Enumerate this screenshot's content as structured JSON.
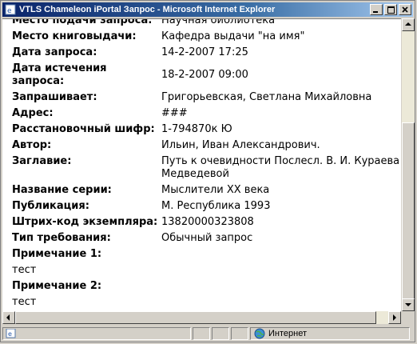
{
  "window": {
    "title": "VTLS Chameleon iPortal Запрос - Microsoft Internet Explorer",
    "buttons": [
      "minimize",
      "maximize",
      "close"
    ]
  },
  "fields": [
    {
      "label": "Место подачи запроса:",
      "value": "Научная библиотека"
    },
    {
      "label": "Место книговыдачи:",
      "value": "Кафедра выдачи \"на имя\""
    },
    {
      "label": "Дата запроса:",
      "value": "14-2-2007 17:25"
    },
    {
      "label": "Дата истечения",
      "label2": "запроса:",
      "value": "18-2-2007 09:00"
    },
    {
      "label": "Запрашивает:",
      "value": "Григорьевская, Светлана Михайловна"
    },
    {
      "label": "Адрес:",
      "value": "###"
    },
    {
      "label": "Расстановочный шифр:",
      "value": "1-794870к Ю"
    },
    {
      "label": "Автор:",
      "value": "Ильин, Иван Александрович."
    },
    {
      "label": "Заглавие:",
      "value": "Путь к очевидности Послесл. В. И. Кураева",
      "value2": "Медведевой"
    },
    {
      "label": "Название серии:",
      "value": "Мыслители XX века"
    },
    {
      "label": "Публикация:",
      "value": "М. Республика 1993"
    },
    {
      "label": "Штрих-код экземпляра:",
      "value": "13820000323808"
    },
    {
      "label": "Тип требования:",
      "value": "Обычный запрос"
    },
    {
      "label": "Примечание 1:",
      "value": ""
    },
    {
      "label": "тест",
      "value": "",
      "plain": true
    },
    {
      "label": "Примечание 2:",
      "value": ""
    },
    {
      "label": "тест",
      "value": "",
      "plain": true
    }
  ],
  "statusbar": {
    "zone": "Интернет"
  },
  "icons": {
    "title": "ie-page-icon",
    "status_left": "ie-page-icon",
    "zone": "globe-icon"
  },
  "colors": {
    "titlebar": "#0a246a",
    "chrome": "#d4d0c8",
    "content": "#ffffff"
  }
}
